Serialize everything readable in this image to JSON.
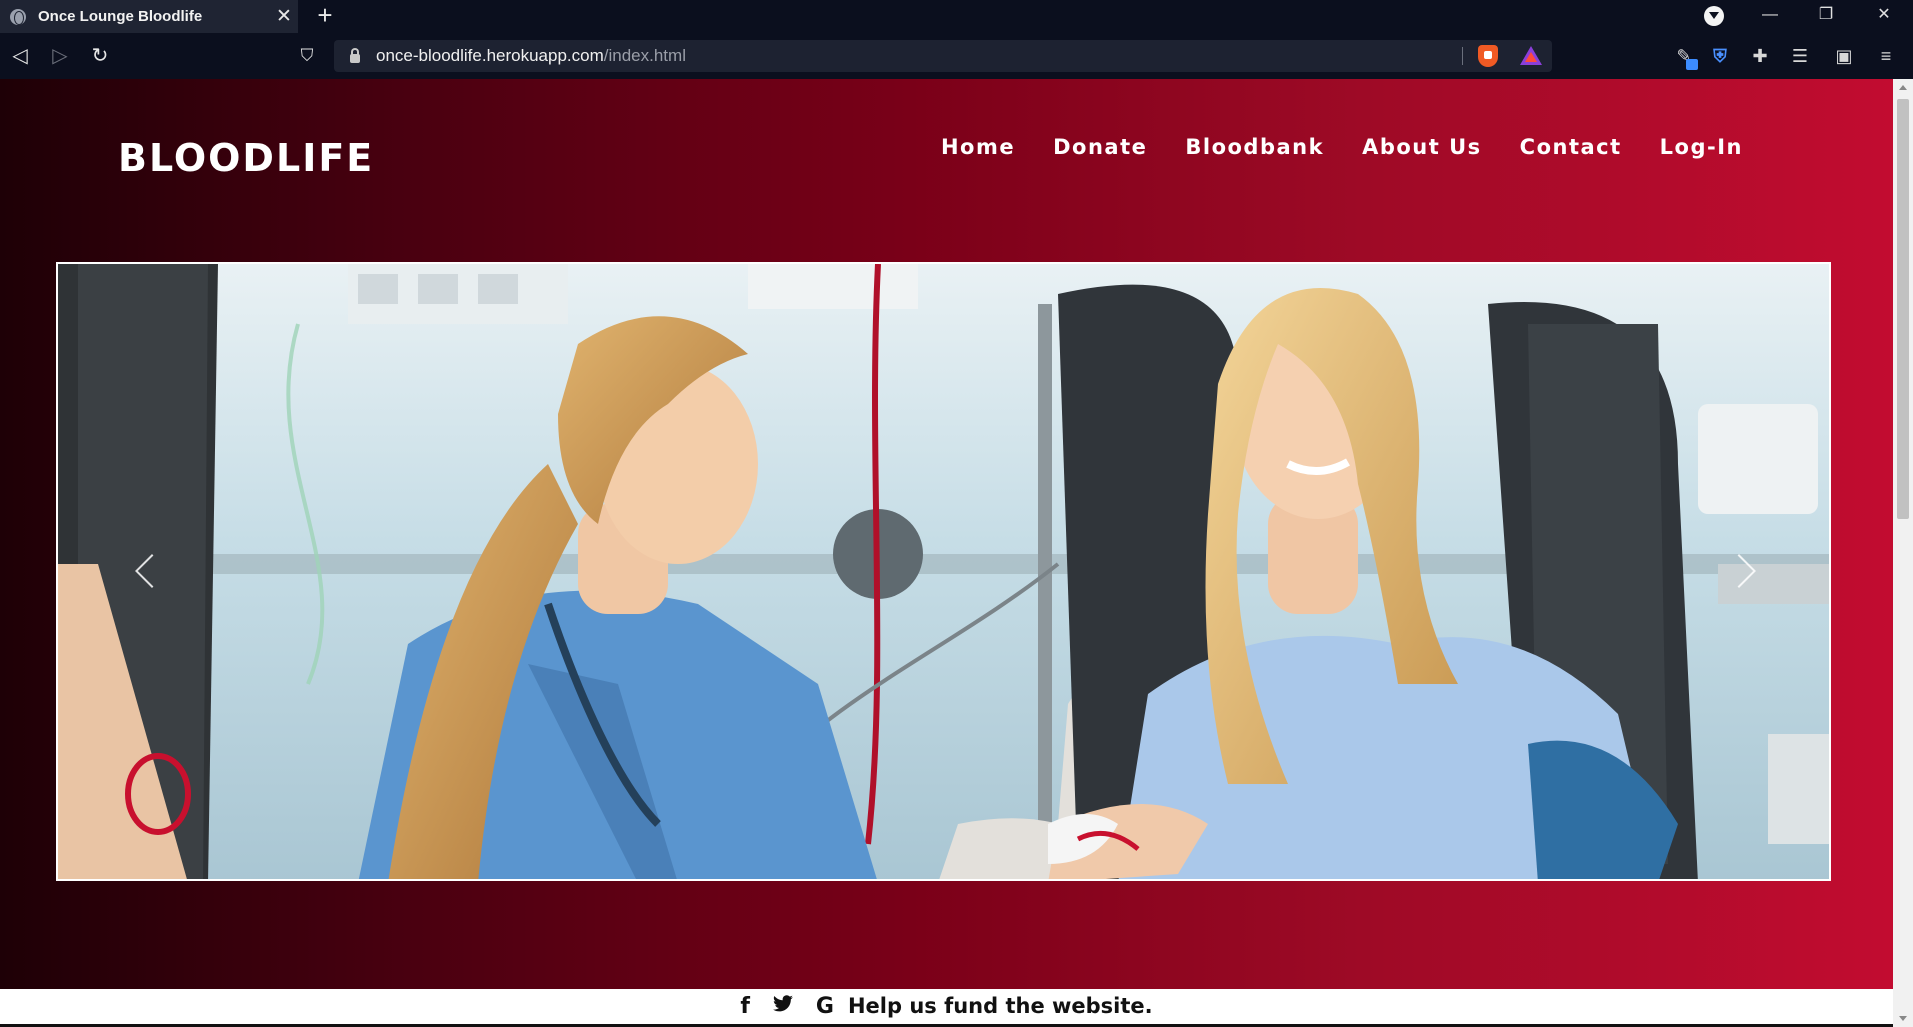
{
  "browser": {
    "tab_title": "Once Lounge Bloodlife",
    "tab_close": "✕",
    "new_tab": "+",
    "url_host": "once-bloodlife.herokuapp.com",
    "url_path": "/index.html",
    "window_controls": {
      "minimize": "—",
      "restore": "❐",
      "close": "✕"
    },
    "nav": {
      "back": "◁",
      "forward": "▷",
      "reload": "↻",
      "bookmark": "⛉"
    }
  },
  "site": {
    "brand": "BLOODLIFE",
    "nav": [
      "Home",
      "Donate",
      "Bloodbank",
      "About Us",
      "Contact",
      "Log-In"
    ],
    "carousel": {
      "prev_icon": "chevron-left-icon",
      "next_icon": "chevron-right-icon"
    },
    "footer": {
      "social_icons": [
        "facebook-icon",
        "twitter-icon",
        "google-icon"
      ],
      "social_glyphs": [
        "f",
        "🐦",
        "G"
      ],
      "text": "Help us fund the website."
    }
  },
  "colors": {
    "gradient_start": "#1e0006",
    "gradient_end": "#c20c30",
    "chrome_bg": "#0b0f1e"
  }
}
